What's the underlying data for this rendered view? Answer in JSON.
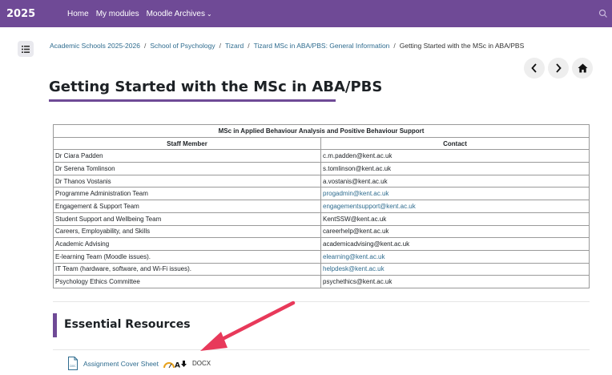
{
  "topbar": {
    "brand": "2025",
    "nav": [
      "Home",
      "My modules",
      "Moodle Archives"
    ]
  },
  "breadcrumb": [
    "Academic Schools 2025-2026",
    "School of Psychology",
    "Tizard",
    "Tizard MSc in ABA/PBS: General Information",
    "Getting Started with the MSc in ABA/PBS"
  ],
  "page": {
    "title": "Getting Started with the MSc in ABA/PBS"
  },
  "table": {
    "caption": "MSc in Applied Behaviour Analysis and Positive Behaviour Support",
    "headers": [
      "Staff Member",
      "Contact"
    ],
    "rows": [
      {
        "member": "Dr Ciara Padden",
        "contact": "c.m.padden@kent.ac.uk"
      },
      {
        "member": "Dr Serena Tomlinson",
        "contact": "s.tomlinson@kent.ac.uk"
      },
      {
        "member": "Dr Thanos Vostanis",
        "contact": "a.vostanis@kent.ac.uk"
      },
      {
        "member": "Programme Administration Team",
        "contact": "progadmin@kent.ac.uk"
      },
      {
        "member": "Engagement & Support Team",
        "contact": "engagementsupport@kent.ac.uk"
      },
      {
        "member": "Student Support and Wellbeing Team",
        "contact": "KentSSW@kent.ac.uk"
      },
      {
        "member": "Careers, Employability, and Skills",
        "contact": "careerhelp@kent.ac.uk"
      },
      {
        "member": "Academic Advising",
        "contact": "academicadvising@kent.ac.uk"
      },
      {
        "member": "E-learning Team (Moodle issues).",
        "contact": "elearning@kent.ac.uk"
      },
      {
        "member": "IT Team (hardware, software, and Wi-Fi issues).",
        "contact": "helpdesk@kent.ac.uk"
      },
      {
        "member": "Psychology Ethics Committee",
        "contact": "psychethics@kent.ac.uk"
      }
    ]
  },
  "section": {
    "title": "Essential Resources"
  },
  "resource": {
    "name": "Assignment Cover Sheet",
    "filetype": "DOCX",
    "icon_label": "DOC"
  },
  "colors": {
    "brand": "#6f4a96",
    "link": "#2f6c8f",
    "arrow": "#e8395a"
  }
}
